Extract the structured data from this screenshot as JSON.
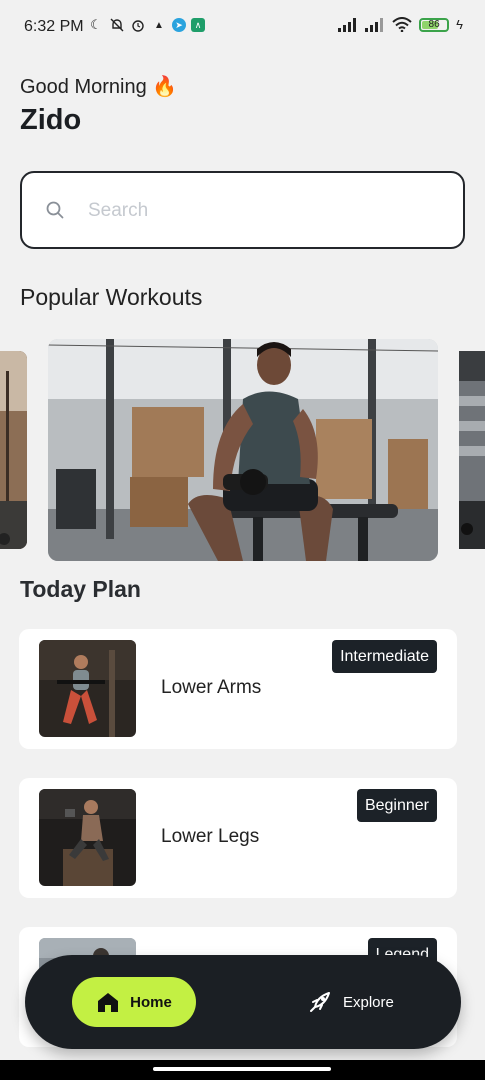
{
  "status_bar": {
    "time": "6:32 PM",
    "battery": "86"
  },
  "header": {
    "greeting": "Good Morning 🔥",
    "user_name": "Zido"
  },
  "search": {
    "placeholder": "Search",
    "value": ""
  },
  "popular": {
    "title": "Popular Workouts"
  },
  "today_plan": {
    "title": "Today Plan",
    "items": [
      {
        "name": "Lower Arms",
        "level": "Intermediate"
      },
      {
        "name": "Lower Legs",
        "level": "Beginner"
      },
      {
        "name": "",
        "level": "Legend"
      }
    ]
  },
  "nav": {
    "home_label": "Home",
    "explore_label": "Explore"
  },
  "colors": {
    "accent": "#c3f043",
    "dark": "#1b1f24",
    "background": "#f1f1f1"
  }
}
